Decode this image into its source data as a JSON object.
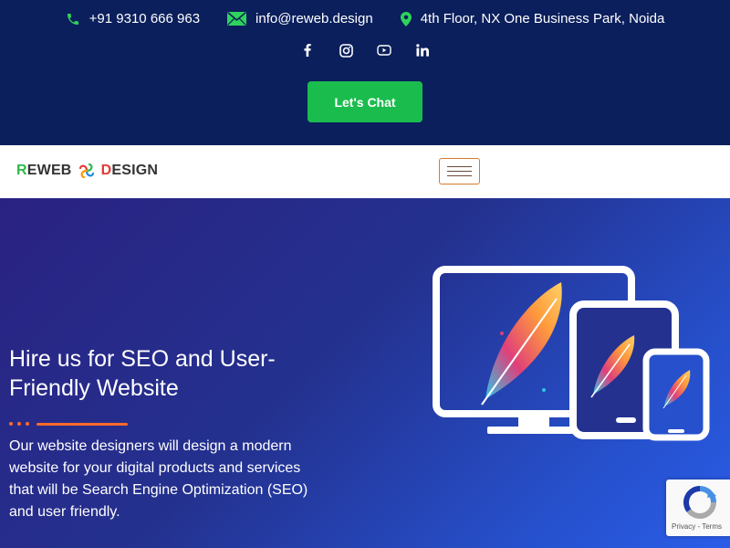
{
  "topbar": {
    "phone": "+91 9310 666 963",
    "email": "info@reweb.design",
    "address": "4th Floor, NX One Business Park, Noida",
    "chat_button": "Let's Chat"
  },
  "colors": {
    "topbar_bg": "#0b1f5c",
    "accent_green": "#1bbc4e",
    "accent_orange": "#ff6a2b",
    "logo_red": "#e53935",
    "logo_green": "#2fb84a"
  },
  "logo": {
    "first_letter": "R",
    "first_rest": "EWEB",
    "second_letter": "D",
    "second_rest": "ESIGN"
  },
  "hero": {
    "title": "Hire us for SEO and User-Friendly Website",
    "description": "Our website designers will design a modern website for your digital products and services that will be Search Engine Optimization (SEO) and user friendly."
  },
  "recaptcha": {
    "privacy": "Privacy",
    "separator": " - ",
    "terms": "Terms"
  },
  "icons": {
    "phone": "phone-icon",
    "email": "envelope-icon",
    "location": "map-pin-icon",
    "socials": [
      "facebook-icon",
      "instagram-icon",
      "youtube-icon",
      "linkedin-icon"
    ]
  }
}
